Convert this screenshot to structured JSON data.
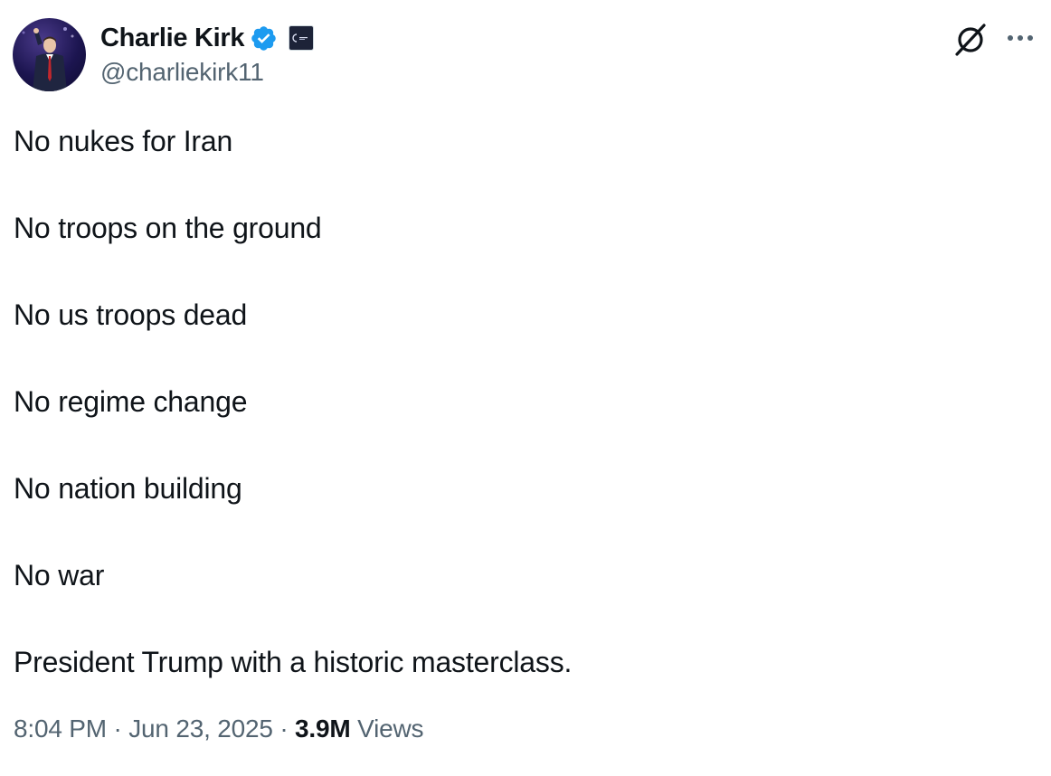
{
  "author": {
    "display_name": "Charlie Kirk",
    "handle": "@charliekirk11",
    "verified": true
  },
  "tweet": {
    "lines": [
      "No nukes for Iran",
      "No troops on the ground",
      "No us troops dead",
      "No regime change",
      "No nation building",
      "No war",
      "President Trump with a historic masterclass."
    ],
    "time": "8:04 PM",
    "separator": "·",
    "date": "Jun 23, 2025",
    "views_count": "3.9M",
    "views_label": "Views"
  },
  "icons": {
    "verified": "verified-badge-icon",
    "affiliate": "affiliate-badge-icon",
    "grok": "grok-icon",
    "more": "more-options-icon"
  },
  "colors": {
    "verified_blue": "#1d9bf0",
    "text_primary": "#0f1419",
    "text_secondary": "#536471"
  }
}
